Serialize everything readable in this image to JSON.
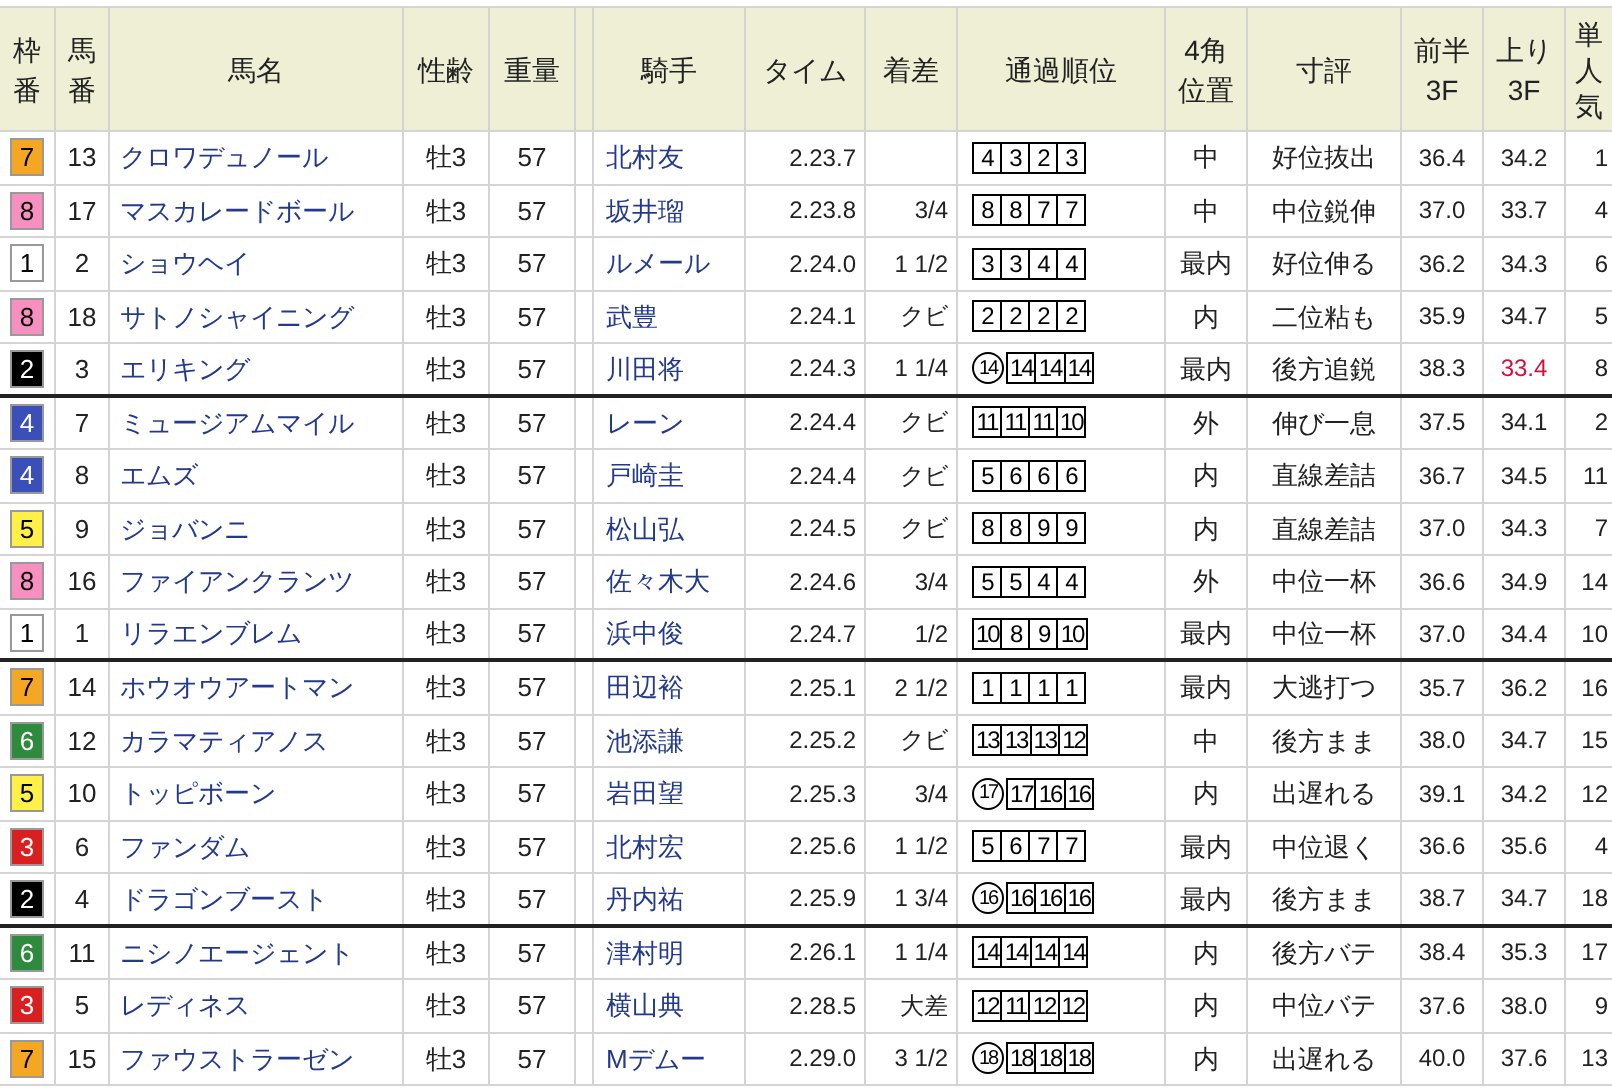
{
  "columns": [
    {
      "lines": [
        "枠",
        "番"
      ]
    },
    {
      "lines": [
        "馬",
        "番"
      ]
    },
    {
      "lines": [
        "馬名"
      ]
    },
    {
      "lines": [
        "性齢"
      ]
    },
    {
      "lines": [
        "重量"
      ]
    },
    {
      "lines": [
        "騎手"
      ]
    },
    {
      "lines": [
        "タイム"
      ]
    },
    {
      "lines": [
        "着差"
      ]
    },
    {
      "lines": [
        "通過順位"
      ]
    },
    {
      "lines": [
        "4角",
        "位置"
      ]
    },
    {
      "lines": [
        "寸評"
      ]
    },
    {
      "lines": [
        "前半",
        "3F"
      ]
    },
    {
      "lines": [
        "上り",
        "3F"
      ]
    },
    {
      "lines": [
        "単",
        "人",
        "気"
      ]
    }
  ],
  "row_groups": [
    [
      {
        "frame": "7",
        "color": "#f5a623",
        "number": "13",
        "horse": "クロワデュノール",
        "sex_age": "牡3",
        "weight": "57",
        "jockey": "北村友",
        "time": "2.23.7",
        "passing": [
          {
            "text": "4",
            "kind": "boxed"
          },
          {
            "text": "3",
            "kind": "boxed"
          },
          {
            "text": "2",
            "kind": "boxed"
          },
          {
            "text": "3",
            "kind": "boxed"
          }
        ],
        "corner": "中",
        "comment": "好位抜出",
        "first_3f": "36.4",
        "last_3f": "34.2",
        "last_3f_best": false,
        "popularity": "1"
      },
      {
        "frame": "8",
        "color": "#f78fc0",
        "number": "17",
        "horse": "マスカレードボール",
        "sex_age": "牡3",
        "weight": "57",
        "jockey": "坂井瑠",
        "time": "2.23.8",
        "margin": "3/4",
        "passing": [
          {
            "text": "8",
            "kind": "boxed"
          },
          {
            "text": "8",
            "kind": "boxed"
          },
          {
            "text": "7",
            "kind": "boxed"
          },
          {
            "text": "7",
            "kind": "boxed"
          }
        ],
        "corner": "中",
        "comment": "中位鋭伸",
        "first_3f": "37.0",
        "last_3f": "33.7",
        "last_3f_best": false,
        "popularity": "4"
      },
      {
        "frame": "1",
        "color": "#ffffff",
        "number": "2",
        "horse": "ショウヘイ",
        "sex_age": "牡3",
        "weight": "57",
        "jockey": "ルメール",
        "time": "2.24.0",
        "margin": "1 1/2",
        "passing": [
          {
            "text": "3",
            "kind": "boxed"
          },
          {
            "text": "3",
            "kind": "boxed"
          },
          {
            "text": "4",
            "kind": "boxed"
          },
          {
            "text": "4",
            "kind": "boxed"
          }
        ],
        "corner": "最内",
        "comment": "好位伸る",
        "first_3f": "36.2",
        "last_3f": "34.3",
        "last_3f_best": false,
        "popularity": "6"
      },
      {
        "frame": "8",
        "color": "#f78fc0",
        "number": "18",
        "horse": "サトノシャイニング",
        "sex_age": "牡3",
        "weight": "57",
        "jockey": "武豊",
        "time": "2.24.1",
        "margin": "クビ",
        "passing": [
          {
            "text": "2",
            "kind": "boxed"
          },
          {
            "text": "2",
            "kind": "boxed"
          },
          {
            "text": "2",
            "kind": "boxed"
          },
          {
            "text": "2",
            "kind": "boxed"
          }
        ],
        "corner": "内",
        "comment": "二位粘も",
        "first_3f": "35.9",
        "last_3f": "34.7",
        "last_3f_best": false,
        "popularity": "5"
      },
      {
        "frame": "2",
        "color": "#000000",
        "number": "3",
        "horse": "エリキング",
        "sex_age": "牡3",
        "weight": "57",
        "jockey": "川田将",
        "time": "2.24.3",
        "margin": "1 1/4",
        "passing": [
          {
            "text": "14",
            "kind": "circled"
          },
          {
            "text": "14",
            "kind": "boxed"
          },
          {
            "text": "14",
            "kind": "boxed"
          },
          {
            "text": "14",
            "kind": "boxed"
          }
        ],
        "corner": "最内",
        "comment": "後方追鋭",
        "first_3f": "38.3",
        "last_3f": "33.4",
        "last_3f_best": true,
        "popularity": "8"
      }
    ],
    [
      {
        "frame": "4",
        "color": "#3b4fb8",
        "number": "7",
        "horse": "ミュージアムマイル",
        "sex_age": "牡3",
        "weight": "57",
        "jockey": "レーン",
        "time": "2.24.4",
        "margin": "クビ",
        "passing": [
          {
            "text": "11",
            "kind": "boxed"
          },
          {
            "text": "11",
            "kind": "boxed"
          },
          {
            "text": "11",
            "kind": "boxed"
          },
          {
            "text": "10",
            "kind": "boxed"
          }
        ],
        "corner": "外",
        "comment": "伸び一息",
        "first_3f": "37.5",
        "last_3f": "34.1",
        "last_3f_best": false,
        "popularity": "2"
      },
      {
        "frame": "4",
        "color": "#3b4fb8",
        "number": "8",
        "horse": "エムズ",
        "sex_age": "牡3",
        "weight": "57",
        "jockey": "戸崎圭",
        "time": "2.24.4",
        "margin": "クビ",
        "passing": [
          {
            "text": "5",
            "kind": "boxed"
          },
          {
            "text": "6",
            "kind": "boxed"
          },
          {
            "text": "6",
            "kind": "boxed"
          },
          {
            "text": "6",
            "kind": "boxed"
          }
        ],
        "corner": "内",
        "comment": "直線差詰",
        "first_3f": "36.7",
        "last_3f": "34.5",
        "last_3f_best": false,
        "popularity": "11"
      },
      {
        "frame": "5",
        "color": "#fff048",
        "number": "9",
        "horse": "ジョバンニ",
        "sex_age": "牡3",
        "weight": "57",
        "jockey": "松山弘",
        "time": "2.24.5",
        "margin": "クビ",
        "passing": [
          {
            "text": "8",
            "kind": "boxed"
          },
          {
            "text": "8",
            "kind": "boxed"
          },
          {
            "text": "9",
            "kind": "boxed"
          },
          {
            "text": "9",
            "kind": "boxed"
          }
        ],
        "corner": "内",
        "comment": "直線差詰",
        "first_3f": "37.0",
        "last_3f": "34.3",
        "last_3f_best": false,
        "popularity": "7"
      },
      {
        "frame": "8",
        "color": "#f78fc0",
        "number": "16",
        "horse": "ファイアンクランツ",
        "sex_age": "牡3",
        "weight": "57",
        "jockey": "佐々木大",
        "time": "2.24.6",
        "margin": "3/4",
        "passing": [
          {
            "text": "5",
            "kind": "boxed"
          },
          {
            "text": "5",
            "kind": "boxed"
          },
          {
            "text": "4",
            "kind": "boxed"
          },
          {
            "text": "4",
            "kind": "boxed"
          }
        ],
        "corner": "外",
        "comment": "中位一杯",
        "first_3f": "36.6",
        "last_3f": "34.9",
        "last_3f_best": false,
        "popularity": "14"
      },
      {
        "frame": "1",
        "color": "#ffffff",
        "number": "1",
        "horse": "リラエンブレム",
        "sex_age": "牡3",
        "weight": "57",
        "jockey": "浜中俊",
        "time": "2.24.7",
        "margin": "1/2",
        "passing": [
          {
            "text": "10",
            "kind": "boxed"
          },
          {
            "text": "8",
            "kind": "boxed"
          },
          {
            "text": "9",
            "kind": "boxed"
          },
          {
            "text": "10",
            "kind": "boxed"
          }
        ],
        "corner": "最内",
        "comment": "中位一杯",
        "first_3f": "37.0",
        "last_3f": "34.4",
        "last_3f_best": false,
        "popularity": "10"
      }
    ],
    [
      {
        "frame": "7",
        "color": "#f5a623",
        "number": "14",
        "horse": "ホウオウアートマン",
        "sex_age": "牡3",
        "weight": "57",
        "jockey": "田辺裕",
        "time": "2.25.1",
        "margin": "2 1/2",
        "passing": [
          {
            "text": "1",
            "kind": "boxed"
          },
          {
            "text": "1",
            "kind": "boxed"
          },
          {
            "text": "1",
            "kind": "boxed"
          },
          {
            "text": "1",
            "kind": "boxed"
          }
        ],
        "corner": "最内",
        "comment": "大逃打つ",
        "first_3f": "35.7",
        "last_3f": "36.2",
        "last_3f_best": false,
        "popularity": "16"
      },
      {
        "frame": "6",
        "color": "#2e8b3e",
        "number": "12",
        "horse": "カラマティアノス",
        "sex_age": "牡3",
        "weight": "57",
        "jockey": "池添謙",
        "time": "2.25.2",
        "margin": "クビ",
        "passing": [
          {
            "text": "13",
            "kind": "boxed"
          },
          {
            "text": "13",
            "kind": "boxed"
          },
          {
            "text": "13",
            "kind": "boxed"
          },
          {
            "text": "12",
            "kind": "boxed"
          }
        ],
        "corner": "中",
        "comment": "後方まま",
        "first_3f": "38.0",
        "last_3f": "34.7",
        "last_3f_best": false,
        "popularity": "15"
      },
      {
        "frame": "5",
        "color": "#fff048",
        "number": "10",
        "horse": "トッピボーン",
        "sex_age": "牡3",
        "weight": "57",
        "jockey": "岩田望",
        "time": "2.25.3",
        "margin": "3/4",
        "passing": [
          {
            "text": "17",
            "kind": "circled"
          },
          {
            "text": "17",
            "kind": "boxed"
          },
          {
            "text": "16",
            "kind": "boxed"
          },
          {
            "text": "16",
            "kind": "boxed"
          }
        ],
        "corner": "内",
        "comment": "出遅れる",
        "first_3f": "39.1",
        "last_3f": "34.2",
        "last_3f_best": false,
        "popularity": "12"
      },
      {
        "frame": "3",
        "color": "#d7201f",
        "number": "6",
        "horse": "ファンダム",
        "sex_age": "牡3",
        "weight": "57",
        "jockey": "北村宏",
        "time": "2.25.6",
        "margin": "1 1/2",
        "passing": [
          {
            "text": "5",
            "kind": "boxed"
          },
          {
            "text": "6",
            "kind": "boxed"
          },
          {
            "text": "7",
            "kind": "boxed"
          },
          {
            "text": "7",
            "kind": "boxed"
          }
        ],
        "corner": "最内",
        "comment": "中位退く",
        "first_3f": "36.6",
        "last_3f": "35.6",
        "last_3f_best": false,
        "popularity": "4"
      },
      {
        "frame": "2",
        "color": "#000000",
        "number": "4",
        "horse": "ドラゴンブースト",
        "sex_age": "牡3",
        "weight": "57",
        "jockey": "丹内祐",
        "time": "2.25.9",
        "margin": "1 3/4",
        "passing": [
          {
            "text": "16",
            "kind": "circled"
          },
          {
            "text": "16",
            "kind": "boxed"
          },
          {
            "text": "16",
            "kind": "boxed"
          },
          {
            "text": "16",
            "kind": "boxed"
          }
        ],
        "corner": "最内",
        "comment": "後方まま",
        "first_3f": "38.7",
        "last_3f": "34.7",
        "last_3f_best": false,
        "popularity": "18"
      }
    ],
    [
      {
        "frame": "6",
        "color": "#2e8b3e",
        "number": "11",
        "horse": "ニシノエージェント",
        "sex_age": "牡3",
        "weight": "57",
        "jockey": "津村明",
        "time": "2.26.1",
        "margin": "1 1/4",
        "passing": [
          {
            "text": "14",
            "kind": "boxed"
          },
          {
            "text": "14",
            "kind": "boxed"
          },
          {
            "text": "14",
            "kind": "boxed"
          },
          {
            "text": "14",
            "kind": "boxed"
          }
        ],
        "corner": "内",
        "comment": "後方バテ",
        "first_3f": "38.4",
        "last_3f": "35.3",
        "last_3f_best": false,
        "popularity": "17"
      },
      {
        "frame": "3",
        "color": "#d7201f",
        "number": "5",
        "horse": "レディネス",
        "sex_age": "牡3",
        "weight": "57",
        "jockey": "横山典",
        "time": "2.28.5",
        "margin": "大差",
        "passing": [
          {
            "text": "12",
            "kind": "boxed"
          },
          {
            "text": "11",
            "kind": "boxed"
          },
          {
            "text": "12",
            "kind": "boxed"
          },
          {
            "text": "12",
            "kind": "boxed"
          }
        ],
        "corner": "内",
        "comment": "中位バテ",
        "first_3f": "37.6",
        "last_3f": "38.0",
        "last_3f_best": false,
        "popularity": "9"
      },
      {
        "frame": "7",
        "color": "#f5a623",
        "number": "15",
        "horse": "ファウストラーゼン",
        "sex_age": "牡3",
        "weight": "57",
        "jockey": "Mデムー",
        "time": "2.29.0",
        "margin": "3 1/2",
        "passing": [
          {
            "text": "18",
            "kind": "circled"
          },
          {
            "text": "18",
            "kind": "boxed"
          },
          {
            "text": "18",
            "kind": "boxed"
          },
          {
            "text": "18",
            "kind": "boxed"
          }
        ],
        "corner": "内",
        "comment": "出遅れる",
        "first_3f": "40.0",
        "last_3f": "37.6",
        "last_3f_best": false,
        "popularity": "13"
      }
    ]
  ]
}
